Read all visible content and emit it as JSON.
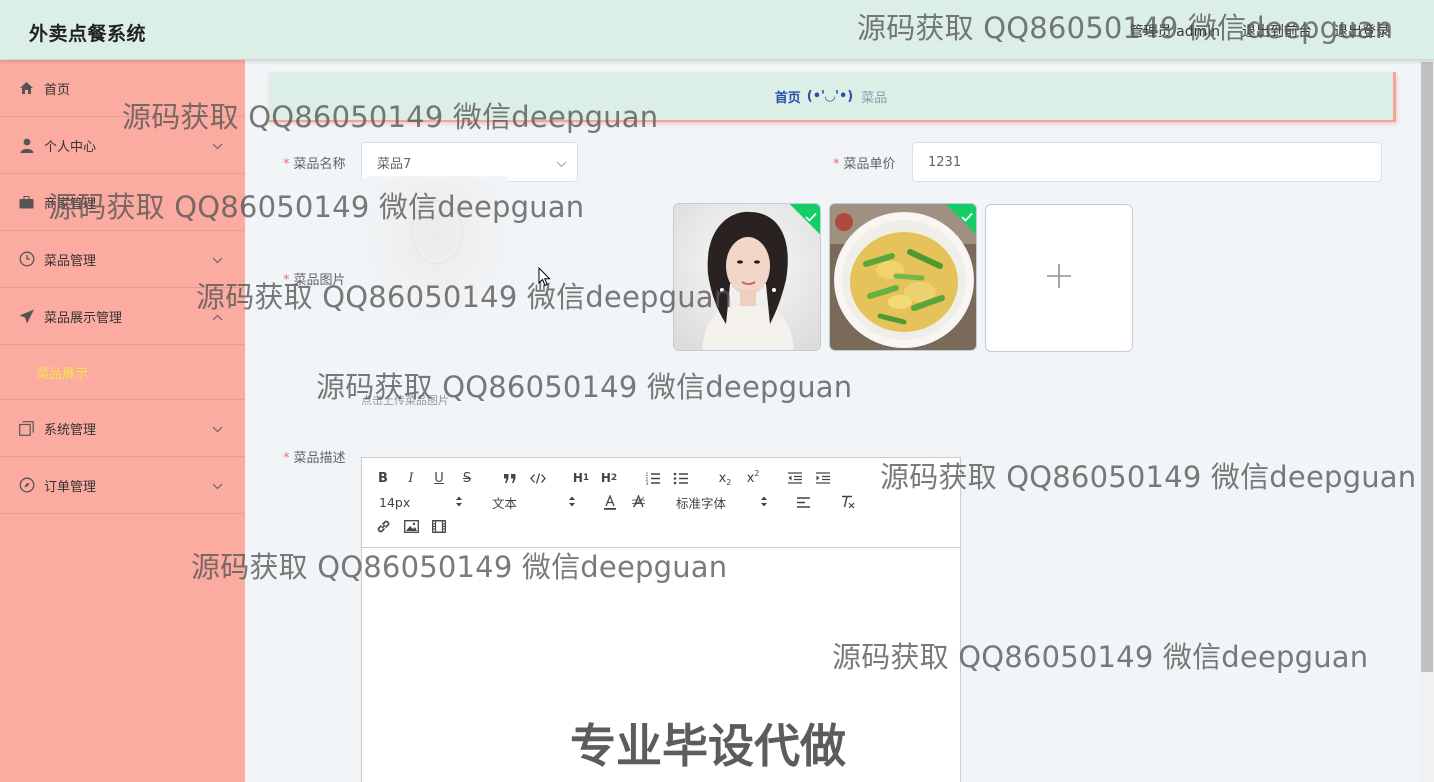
{
  "header": {
    "title": "外卖点餐系统",
    "admin_text": "管理员 admin",
    "to_front": "退出到前台",
    "logout": "退出登录"
  },
  "sidebar": {
    "items": [
      {
        "label": "首页",
        "icon": "home-icon"
      },
      {
        "label": "个人中心",
        "icon": "user-icon"
      },
      {
        "label": "商家管理",
        "icon": "briefcase-icon"
      },
      {
        "label": "菜品管理",
        "icon": "clock-icon"
      },
      {
        "label": "菜品展示管理",
        "icon": "send-icon"
      },
      {
        "label": "系统管理",
        "icon": "copy-icon"
      },
      {
        "label": "订单管理",
        "icon": "compass-icon"
      }
    ],
    "sub_item": "菜品展示"
  },
  "breadcrumb": {
    "home": "首页",
    "face": "(•'◡'•)",
    "current": "菜品"
  },
  "form": {
    "name_label": "菜品名称",
    "name_value": "菜品7",
    "price_label": "菜品单价",
    "price_value": "1231",
    "image_label": "菜品图片",
    "upload_tip": "点击上传菜品图片",
    "desc_label": "菜品描述"
  },
  "editor": {
    "font_size": "14px",
    "paragraph": "文本",
    "font_family": "标准字体"
  },
  "watermark": {
    "text": "源码获取 QQ86050149 微信deepguan",
    "big": "专业毕设代做"
  },
  "colors": {
    "header_bg": "#dcefe6",
    "sidebar_bg": "#fcaba1",
    "active_sub": "#f5e44a",
    "breadcrumb_link": "#2b4ea8",
    "success": "#13ce66"
  }
}
